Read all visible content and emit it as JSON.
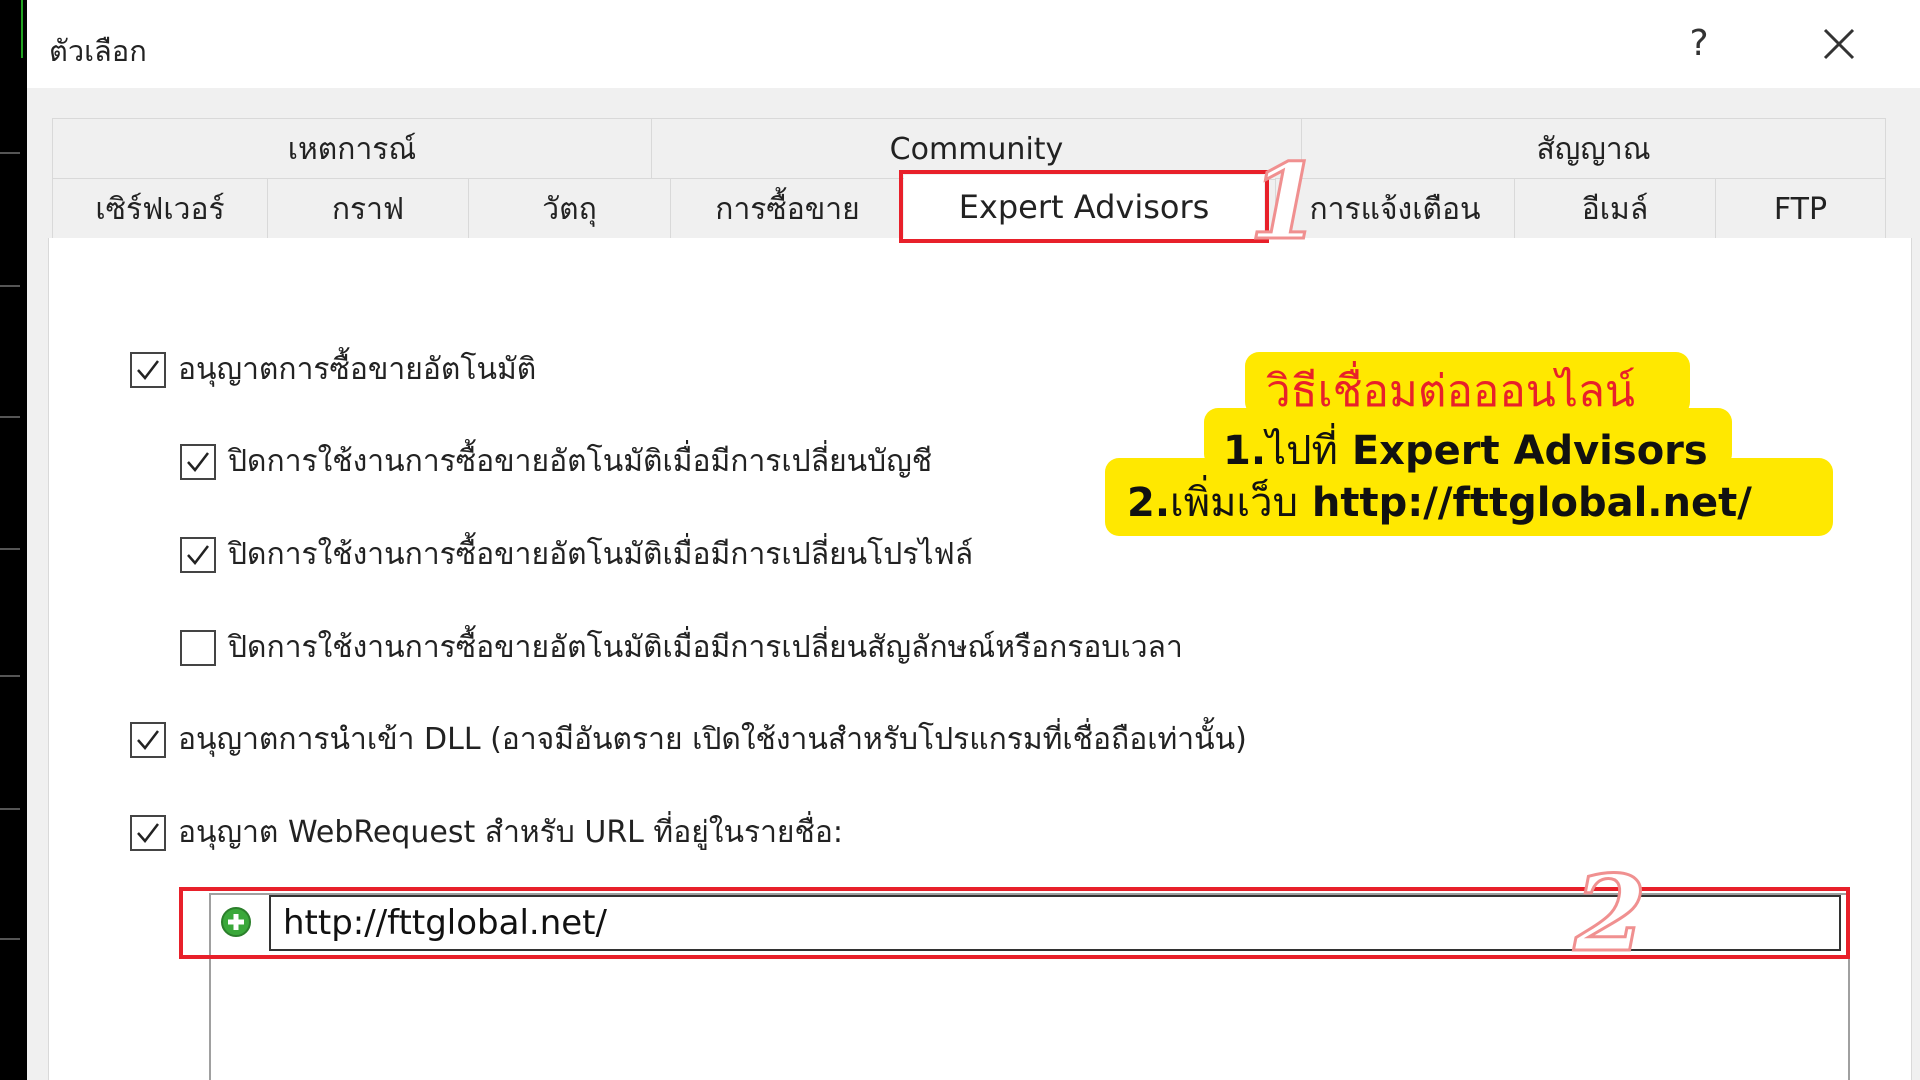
{
  "window": {
    "title": "ตัวเลือก",
    "help_label": "?",
    "close_icon": "close-icon"
  },
  "tabs_row1": [
    "เหตการณ์",
    "Community",
    "สัญญาณ"
  ],
  "tabs_row2": [
    "เซิร์ฟเวอร์",
    "กราฟ",
    "วัตถุ",
    "การซื้อขาย",
    "Expert Advisors",
    "การแจ้งเตือน",
    "อีเมล์",
    "FTP"
  ],
  "active_tab": "Expert Advisors",
  "options": [
    {
      "label": "อนุญาตการซื้อขายอัตโนมัติ",
      "checked": true
    },
    {
      "label": "ปิดการใช้งานการซื้อขายอัตโนมัติเมื่อมีการเปลี่ยนบัญชี",
      "checked": true
    },
    {
      "label": "ปิดการใช้งานการซื้อขายอัตโนมัติเมื่อมีการเปลี่ยนโปรไฟล์",
      "checked": true
    },
    {
      "label": "ปิดการใช้งานการซื้อขายอัตโนมัติเมื่อมีการเปลี่ยนสัญลักษณ์หรือกรอบเวลา",
      "checked": false
    },
    {
      "label": "อนุญาตการนำเข้า DLL (อาจมีอันตราย เปิดใช้งานสำหรับโปรแกรมที่เชื่อถือเท่านั้น)",
      "checked": true
    },
    {
      "label": "อนุญาต WebRequest สำหรับ URL ที่อยู่ในรายชื่อ:",
      "checked": true
    }
  ],
  "url_list": {
    "value": "http://fttglobal.net/",
    "add_icon": "add-circle-icon"
  },
  "annotation": {
    "heading": "วิธีเชื่อมต่อออนไลน์",
    "step1_num": "1.",
    "step1_text": "ไปที่",
    "step1_bold": "Expert Advisors",
    "step2_num": "2.",
    "step2_text": "เพิ่มเว็บ",
    "step2_bold": "http://fttglobal.net/",
    "marker1": "1",
    "marker2": "2",
    "highlight_color": "#ffe800",
    "heading_color": "#e8202a",
    "box_color": "#e8202a"
  }
}
